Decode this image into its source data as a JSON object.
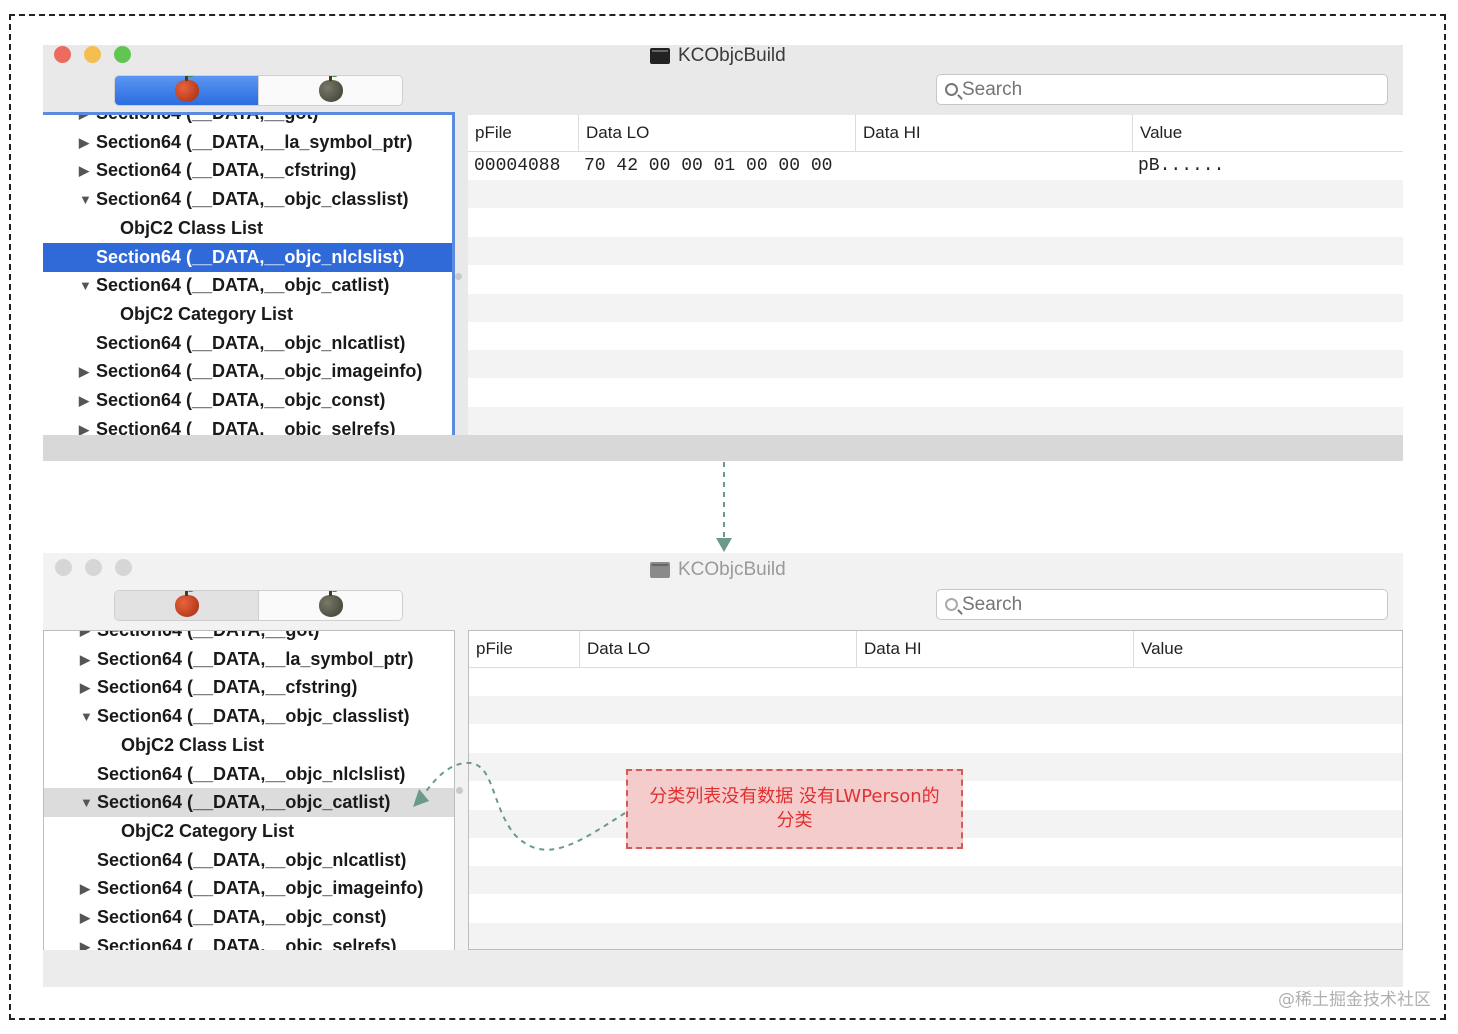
{
  "window_title": "KCObjcBuild",
  "search_placeholder": "Search",
  "tree_top": [
    {
      "label": "Section64 (__DATA,__got)",
      "toggle": "▶",
      "level": 0,
      "state": "cut"
    },
    {
      "label": "Section64 (__DATA,__la_symbol_ptr)",
      "toggle": "▶",
      "level": 0,
      "state": ""
    },
    {
      "label": "Section64 (__DATA,__cfstring)",
      "toggle": "▶",
      "level": 0,
      "state": ""
    },
    {
      "label": "Section64 (__DATA,__objc_classlist)",
      "toggle": "▼",
      "level": 0,
      "state": ""
    },
    {
      "label": "ObjC2 Class List",
      "toggle": "",
      "level": 1,
      "state": ""
    },
    {
      "label": "Section64 (__DATA,__objc_nlclslist)",
      "toggle": "",
      "level": 0,
      "state": "selected"
    },
    {
      "label": "Section64 (__DATA,__objc_catlist)",
      "toggle": "▼",
      "level": 0,
      "state": ""
    },
    {
      "label": "ObjC2 Category List",
      "toggle": "",
      "level": 1,
      "state": ""
    },
    {
      "label": "Section64 (__DATA,__objc_nlcatlist)",
      "toggle": "",
      "level": 0,
      "state": ""
    },
    {
      "label": "Section64 (__DATA,__objc_imageinfo)",
      "toggle": "▶",
      "level": 0,
      "state": ""
    },
    {
      "label": "Section64 (__DATA,__objc_const)",
      "toggle": "▶",
      "level": 0,
      "state": ""
    },
    {
      "label": "Section64 (__DATA,__objc_selrefs)",
      "toggle": "▶",
      "level": 0,
      "state": "cut"
    }
  ],
  "tree_bottom": [
    {
      "label": "Section64 (__DATA,__got)",
      "toggle": "▶",
      "level": 0,
      "state": "cut"
    },
    {
      "label": "Section64 (__DATA,__la_symbol_ptr)",
      "toggle": "▶",
      "level": 0,
      "state": ""
    },
    {
      "label": "Section64 (__DATA,__cfstring)",
      "toggle": "▶",
      "level": 0,
      "state": ""
    },
    {
      "label": "Section64 (__DATA,__objc_classlist)",
      "toggle": "▼",
      "level": 0,
      "state": ""
    },
    {
      "label": "ObjC2 Class List",
      "toggle": "",
      "level": 1,
      "state": ""
    },
    {
      "label": "Section64 (__DATA,__objc_nlclslist)",
      "toggle": "",
      "level": 0,
      "state": ""
    },
    {
      "label": "Section64 (__DATA,__objc_catlist)",
      "toggle": "▼",
      "level": 0,
      "state": "highlighted"
    },
    {
      "label": "ObjC2 Category List",
      "toggle": "",
      "level": 1,
      "state": ""
    },
    {
      "label": "Section64 (__DATA,__objc_nlcatlist)",
      "toggle": "",
      "level": 0,
      "state": ""
    },
    {
      "label": "Section64 (__DATA,__objc_imageinfo)",
      "toggle": "▶",
      "level": 0,
      "state": ""
    },
    {
      "label": "Section64 (__DATA,__objc_const)",
      "toggle": "▶",
      "level": 0,
      "state": ""
    },
    {
      "label": "Section64 (__DATA,__objc_selrefs)",
      "toggle": "▶",
      "level": 0,
      "state": "cut"
    }
  ],
  "grid_columns": [
    "pFile",
    "Data LO",
    "Data HI",
    "Value"
  ],
  "grid_top_rows": [
    {
      "pfile": "00004088",
      "data_lo": "70 42 00 00 01 00 00 00",
      "data_hi": "",
      "value": "pB......"
    }
  ],
  "grid_bottom_rows": [],
  "annotation": {
    "line1": "分类列表没有数据 没有LWPerson的",
    "line2": "分类"
  },
  "watermark": "@稀土掘金技术社区",
  "colors": {
    "selection": "#2f6ad8",
    "traffic_red": "#ed6a5e",
    "traffic_yellow": "#f5bf4f",
    "traffic_green": "#61c554",
    "annotation_bg": "#f5cccc",
    "annotation_text": "#e03030",
    "arrow": "#6a9a8a"
  },
  "icons": {
    "window": "document-icon",
    "segment_left": "red-apple-icon",
    "segment_right": "dark-apple-icon",
    "search": "magnifier-icon"
  }
}
